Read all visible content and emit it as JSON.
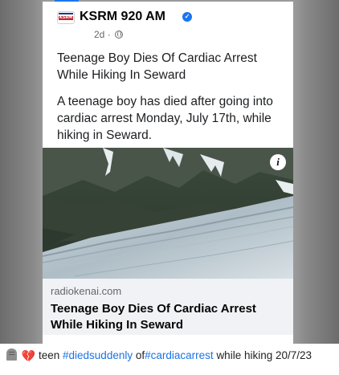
{
  "post": {
    "page_name": "KSRM 920 AM",
    "avatar_text": "KSRM",
    "timestamp": "2d",
    "meta_separator": "·",
    "text_paragraphs": [
      "Teenage Boy Dies Of Cardiac Arrest While Hiking In Seward",
      "A teenage boy has died after going into cardiac arrest Monday, July 17th, while hiking in Seward."
    ],
    "link": {
      "domain": "radiokenai.com",
      "title": "Teenage Boy Dies Of Cardiac Arrest While Hiking In Seward"
    }
  },
  "caption": {
    "word1": "teen",
    "hashtag1": "#diedsuddenly",
    "word2": "of",
    "hashtag2": "#cardiacarrest",
    "rest": "while hiking 20/7/23"
  },
  "icons": {
    "verified": "verified-badge-icon",
    "audience": "globe-icon",
    "info": "info-icon",
    "tombstone": "headstone-icon",
    "broken_heart": "broken-heart-icon"
  },
  "colors": {
    "facebook_blue": "#1877f2",
    "hashtag": "#1a73e8",
    "link_footer_bg": "#f0f2f5"
  }
}
